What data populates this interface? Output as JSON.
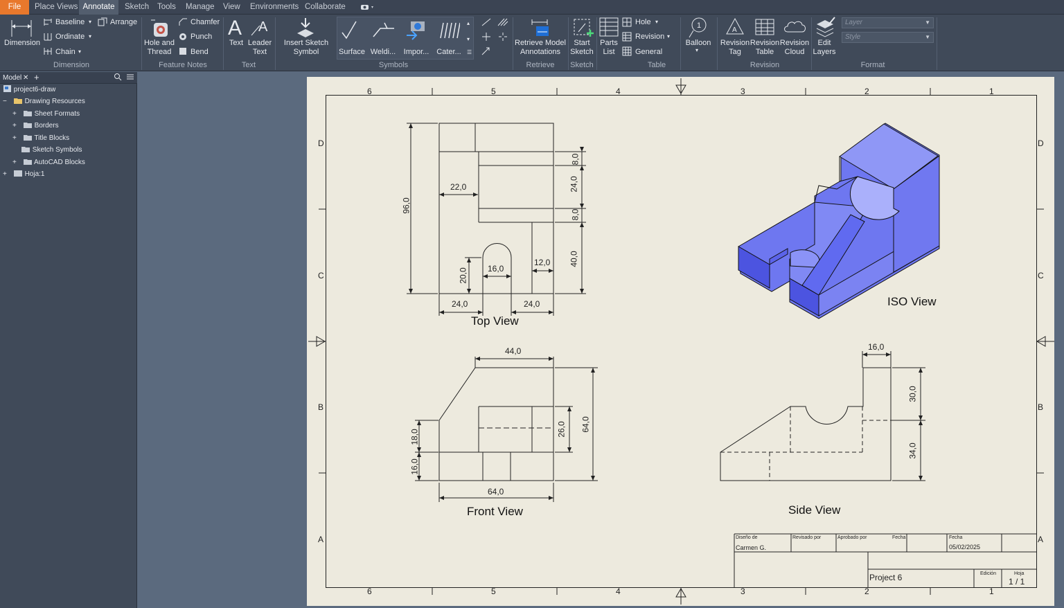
{
  "menu": {
    "items": [
      "File",
      "Place Views",
      "Annotate",
      "Sketch",
      "Tools",
      "Manage",
      "View",
      "Environments",
      "Collaborate"
    ]
  },
  "ribbon": {
    "dimension": {
      "label": "Dimension",
      "baseline": "Baseline",
      "ordinate": "Ordinate",
      "chain": "Chain",
      "arrange": "Arrange",
      "group": "Dimension"
    },
    "feature_notes": {
      "hole_thread": "Hole and Thread",
      "chamfer": "Chamfer",
      "punch": "Punch",
      "bend": "Bend",
      "group": "Feature Notes"
    },
    "text": {
      "text": "Text",
      "leader_text": "Leader Text",
      "group": "Text"
    },
    "symbols": {
      "insert_sketch_symbol": "Insert Sketch Symbol",
      "surface": "Surface",
      "welding": "Weldi...",
      "import": "Impor...",
      "caterpillar": "Cater...",
      "group": "Symbols"
    },
    "retrieve": {
      "retrieve_model": "Retrieve Model Annotations",
      "group": "Retrieve"
    },
    "sketch": {
      "start_sketch": "Start Sketch",
      "group": "Sketch"
    },
    "table": {
      "parts_list": "Parts List",
      "hole": "Hole",
      "revision": "Revision",
      "general": "General",
      "group": "Table"
    },
    "balloon": {
      "label": "Balloon"
    },
    "revision": {
      "tag": "Revision Tag",
      "table": "Revision Table",
      "cloud": "Revision Cloud",
      "group": "Revision"
    },
    "format": {
      "edit_layers": "Edit Layers",
      "layer_placeholder": "Layer",
      "style_placeholder": "Style",
      "group": "Format"
    }
  },
  "browser": {
    "tab": "Model",
    "tree": [
      {
        "label": "project6-draw"
      },
      {
        "label": "Drawing Resources"
      },
      {
        "label": "Sheet Formats"
      },
      {
        "label": "Borders"
      },
      {
        "label": "Title Blocks"
      },
      {
        "label": "Sketch Symbols"
      },
      {
        "label": "AutoCAD Blocks"
      },
      {
        "label": "Hoja:1"
      }
    ]
  },
  "sheet": {
    "zones_h": [
      "6",
      "5",
      "4",
      "3",
      "2",
      "1"
    ],
    "zones_v": [
      "D",
      "C",
      "B",
      "A"
    ],
    "views": {
      "top": "Top View",
      "front": "Front View",
      "side": "Side View",
      "iso": "ISO View"
    },
    "dims": {
      "top": [
        "96,0",
        "22,0",
        "8,0",
        "24,0",
        "8,0",
        "40,0",
        "20,0",
        "16,0",
        "12,0",
        "24,0",
        "24,0"
      ],
      "front": [
        "44,0",
        "18,0",
        "16,0",
        "26,0",
        "64,0",
        "64,0"
      ],
      "side": [
        "16,0",
        "30,0",
        "34,0"
      ]
    },
    "title_block": {
      "designed_label": "Diseño de",
      "designed_by": "Carmen G.",
      "reviewed_label": "Revisado por",
      "approved_label": "Aprobado por",
      "date_label": "Fecha",
      "date_label2": "Fecha",
      "date": "05/02/2025",
      "title": "Project 6",
      "edition_label": "Edición",
      "sheet_label": "Hoja",
      "sheet": "1 / 1"
    }
  },
  "colors": {
    "file_tab": "#e8782c",
    "iso_fill": "#6f78f0",
    "paper": "#edeade"
  }
}
